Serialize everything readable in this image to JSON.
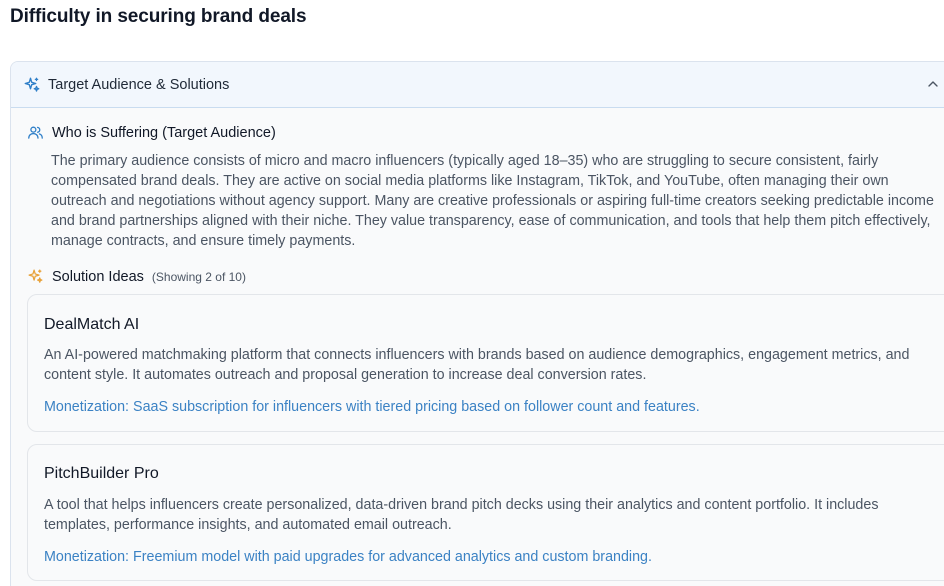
{
  "page": {
    "title": "Difficulty in securing brand deals"
  },
  "panel": {
    "title": "Target Audience & Solutions",
    "icons": {
      "header": "sparkles-icon",
      "toggle": "chevron-up-icon"
    }
  },
  "audience": {
    "title": "Who is Suffering (Target Audience)",
    "icon": "users-icon",
    "description": "The primary audience consists of micro and macro influencers (typically aged 18–35) who are struggling to secure consistent, fairly compensated brand deals. They are active on social media platforms like Instagram, TikTok, and YouTube, often managing their own outreach and negotiations without agency support. Many are creative professionals or aspiring full-time creators seeking predictable income and brand partnerships aligned with their niche. They value transparency, ease of communication, and tools that help them pitch effectively, manage contracts, and ensure timely payments."
  },
  "solutions": {
    "title": "Solution Ideas",
    "subtitle": "(Showing 2 of 10)",
    "icon": "sparkles-icon",
    "items": [
      {
        "name": "DealMatch AI",
        "description": "An AI-powered matchmaking platform that connects influencers with brands based on audience demographics, engagement metrics, and content style. It automates outreach and proposal generation to increase deal conversion rates.",
        "monetization_label": "Monetization:",
        "monetization": "SaaS subscription for influencers with tiered pricing based on follower count and features."
      },
      {
        "name": "PitchBuilder Pro",
        "description": "A tool that helps influencers create personalized, data-driven brand pitch decks using their analytics and content portfolio. It includes templates, performance insights, and automated email outreach.",
        "monetization_label": "Monetization:",
        "monetization": "Freemium model with paid upgrades for advanced analytics and custom branding."
      }
    ]
  },
  "colors": {
    "accent_blue": "#3b82c4",
    "sparkle_orange": "#e8a23a",
    "header_bg": "#f2f7fd"
  }
}
